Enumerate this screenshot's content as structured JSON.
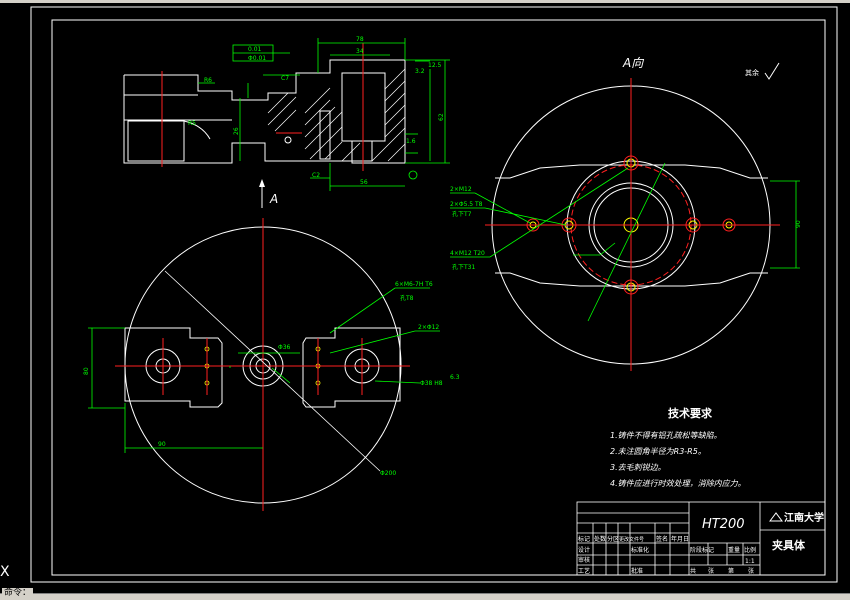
{
  "status": {
    "command_line": "命令："
  },
  "ucs_icon": "ucs-x-axis-icon",
  "drawing": {
    "view_label_a": "A",
    "view_title": "A向",
    "roughness_other": "其余",
    "tech_title": "技术要求",
    "tech_items": [
      "1.铸件不得有铝孔疏松等缺陷。",
      "2.未注圆角半径为R3-R5。",
      "3.去毛刺锐边。",
      "4.铸件应进行时效处理，消除内应力。"
    ],
    "material": "HT200",
    "school": "江南大学",
    "part_name": "夹具体",
    "tb_row1": [
      "标记",
      "处数",
      "分区",
      "更改文件号",
      "签名",
      "年月日"
    ],
    "tb_row2": [
      "设计",
      "标准化"
    ],
    "tb_row3": [
      "审核"
    ],
    "tb_row4": [
      "工艺",
      "批准"
    ],
    "tb_stage": [
      "阶段标记",
      "重量",
      "比例"
    ],
    "tb_scale": "1:1",
    "tb_sheets": [
      "共",
      "张",
      "第",
      "张"
    ],
    "dims": {
      "d78": "78",
      "d34": "34",
      "d56": "56",
      "d62": "62",
      "d80": "80",
      "d90": "90",
      "d26": "26",
      "c7": "C7",
      "c2": "C2",
      "r6": "R6",
      "r5": "R5",
      "holes1": "2×M12",
      "holes2": "2×Φ5.5 T8",
      "holes2b": "孔下T7",
      "holes3": "4×M12 T20",
      "holes3b": "孔下T31",
      "holes4": "6×M6-7H T6",
      "holes4b": "孔T8",
      "holes5": "2×Φ12",
      "phi200": "Φ200",
      "phi36": "Φ36",
      "phi38": "Φ38 H8",
      "tol1": "0.01",
      "tol2": "Φ0.01",
      "ra32": "3.2",
      "ra125": "12.5",
      "ra16": "1.6",
      "ra63": "6.3"
    }
  }
}
